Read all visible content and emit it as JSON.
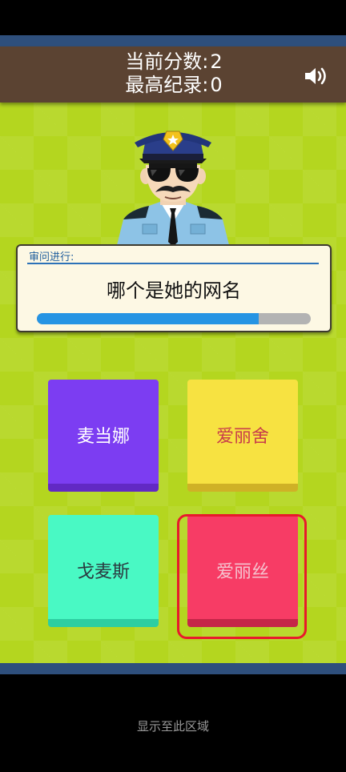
{
  "header": {
    "current_score_label": "当前分数:",
    "current_score": "2",
    "best_score_label": "最高纪录:",
    "best_score": "0",
    "sound_icon": "speaker-volume-icon"
  },
  "question": {
    "panel_title": "审问进行:",
    "text": "哪个是她的网名",
    "timer_progress": 0.81
  },
  "answers": [
    {
      "label": "麦当娜",
      "color": "#7c3df2"
    },
    {
      "label": "爱丽舍",
      "color": "#f7e241"
    },
    {
      "label": "戈麦斯",
      "color": "#49f9c4"
    },
    {
      "label": "爱丽丝",
      "color": "#f73c65"
    }
  ],
  "footer": {
    "text": "显示至此区域"
  },
  "colors": {
    "board": "#b4d61f",
    "header": "#5b4332",
    "strip": "#2e4f7c",
    "highlight": "#e8192c"
  }
}
